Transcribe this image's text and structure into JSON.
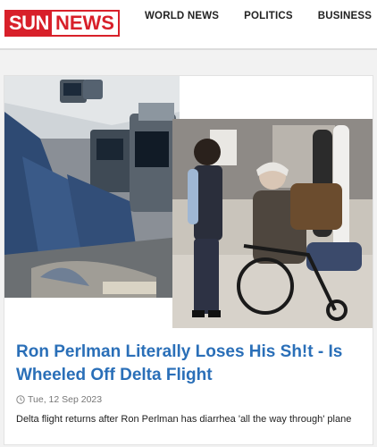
{
  "header": {
    "logo": {
      "part1": "SUN",
      "part2": "NEWS"
    },
    "nav": [
      {
        "label": "WORLD NEWS"
      },
      {
        "label": "POLITICS"
      },
      {
        "label": "BUSINESS"
      }
    ]
  },
  "article": {
    "title": "Ron Perlman Literally Loses His Sh!t - Is Wheeled Off Delta Flight",
    "date": "Tue, 12 Sep 2023",
    "summary": "Delta flight returns after Ron Perlman has diarrhea 'all the way through' plane",
    "image": {
      "left_panel": "airplane-cabin-seats",
      "right_panel": "man-in-wheelchair-airport"
    }
  },
  "icons": {
    "date": "clock-icon"
  },
  "colors": {
    "brand_red": "#d8202a",
    "link_blue": "#2a6fb8"
  }
}
